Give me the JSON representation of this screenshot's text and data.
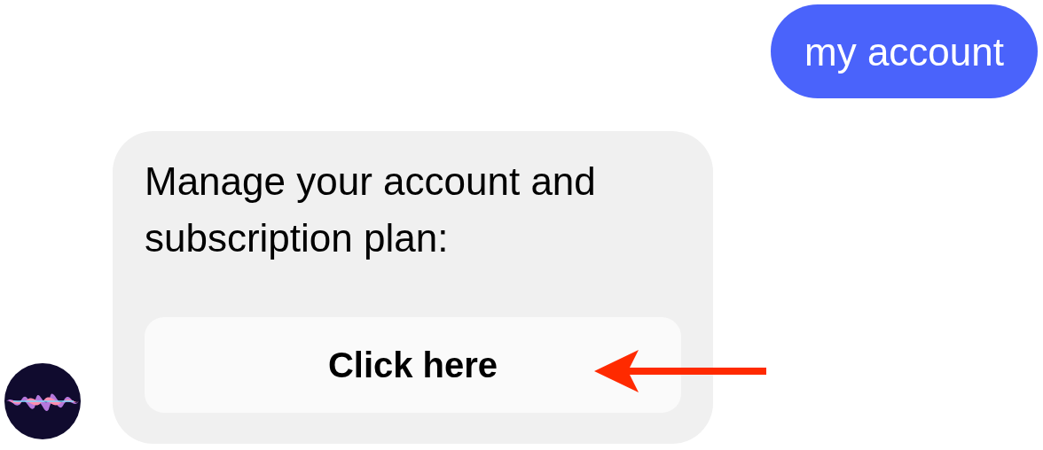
{
  "messages": [
    {
      "kind": "user",
      "text": "my account"
    },
    {
      "kind": "bot",
      "text": "Manage your account and subscription plan:",
      "button": "Click here"
    }
  ]
}
